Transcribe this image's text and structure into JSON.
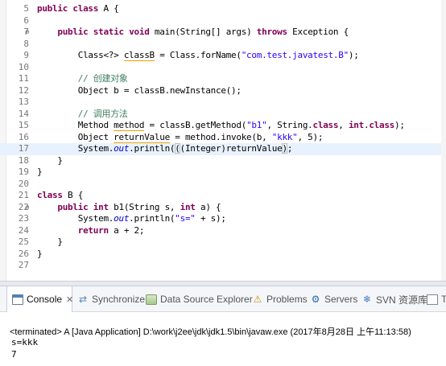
{
  "editor": {
    "lines": [
      {
        "num": "5",
        "fold": "",
        "current": false,
        "tokens": [
          {
            "t": "public",
            "c": "kw"
          },
          {
            "t": " "
          },
          {
            "t": "class",
            "c": "kw"
          },
          {
            "t": " A {"
          }
        ]
      },
      {
        "num": "6",
        "fold": "",
        "current": false,
        "tokens": []
      },
      {
        "num": "7",
        "fold": "⊖",
        "current": false,
        "tokens": [
          {
            "t": "    "
          },
          {
            "t": "public",
            "c": "kw"
          },
          {
            "t": " "
          },
          {
            "t": "static",
            "c": "kw"
          },
          {
            "t": " "
          },
          {
            "t": "void",
            "c": "kw"
          },
          {
            "t": " main(String[] args) "
          },
          {
            "t": "throws",
            "c": "kw"
          },
          {
            "t": " Exception {"
          }
        ]
      },
      {
        "num": "8",
        "fold": "",
        "current": false,
        "tokens": []
      },
      {
        "num": "9",
        "fold": "",
        "current": false,
        "tokens": [
          {
            "t": "        Class<?> "
          },
          {
            "t": "classB",
            "c": "warn"
          },
          {
            "t": " = Class.forName("
          },
          {
            "t": "\"com.test.javatest.B\"",
            "c": "str"
          },
          {
            "t": ");"
          }
        ]
      },
      {
        "num": "10",
        "fold": "",
        "current": false,
        "tokens": []
      },
      {
        "num": "11",
        "fold": "",
        "current": false,
        "tokens": [
          {
            "t": "        "
          },
          {
            "t": "// 创建对象",
            "c": "cm"
          }
        ]
      },
      {
        "num": "12",
        "fold": "",
        "current": false,
        "tokens": [
          {
            "t": "        Object b = classB.newInstance();"
          }
        ]
      },
      {
        "num": "13",
        "fold": "",
        "current": false,
        "tokens": []
      },
      {
        "num": "14",
        "fold": "",
        "current": false,
        "tokens": [
          {
            "t": "        "
          },
          {
            "t": "// 调用方法",
            "c": "cm"
          }
        ]
      },
      {
        "num": "15",
        "fold": "",
        "current": false,
        "tokens": [
          {
            "t": "        Method "
          },
          {
            "t": "method",
            "c": "warn"
          },
          {
            "t": " = classB.getMethod("
          },
          {
            "t": "\"b1\"",
            "c": "str"
          },
          {
            "t": ", String."
          },
          {
            "t": "class",
            "c": "kw"
          },
          {
            "t": ", "
          },
          {
            "t": "int",
            "c": "kw"
          },
          {
            "t": "."
          },
          {
            "t": "class",
            "c": "kw"
          },
          {
            "t": ");"
          }
        ]
      },
      {
        "num": "16",
        "fold": "",
        "current": false,
        "tokens": [
          {
            "t": "        Object "
          },
          {
            "t": "returnValue",
            "c": "warn"
          },
          {
            "t": " = method.invoke(b, "
          },
          {
            "t": "\"kkk\"",
            "c": "str"
          },
          {
            "t": ", 5);"
          }
        ]
      },
      {
        "num": "17",
        "fold": "",
        "current": true,
        "tokens": [
          {
            "t": "        System."
          },
          {
            "t": "out",
            "c": "fld"
          },
          {
            "t": ".println("
          },
          {
            "t": "(",
            "c": "bkt"
          },
          {
            "t": "(Integer)returnValue"
          },
          {
            "t": ")",
            "c": "bkt"
          },
          {
            "t": ";"
          }
        ]
      },
      {
        "num": "18",
        "fold": "",
        "current": false,
        "tokens": [
          {
            "t": "    }"
          }
        ]
      },
      {
        "num": "19",
        "fold": "",
        "current": false,
        "tokens": [
          {
            "t": "}"
          }
        ]
      },
      {
        "num": "20",
        "fold": "",
        "current": false,
        "tokens": []
      },
      {
        "num": "21",
        "fold": "",
        "current": false,
        "tokens": [
          {
            "t": "class",
            "c": "kw"
          },
          {
            "t": " B {"
          }
        ]
      },
      {
        "num": "22",
        "fold": "⊖",
        "current": false,
        "tokens": [
          {
            "t": "    "
          },
          {
            "t": "public",
            "c": "kw"
          },
          {
            "t": " "
          },
          {
            "t": "int",
            "c": "kw"
          },
          {
            "t": " b1(String s, "
          },
          {
            "t": "int",
            "c": "kw"
          },
          {
            "t": " a) {"
          }
        ]
      },
      {
        "num": "23",
        "fold": "",
        "current": false,
        "tokens": [
          {
            "t": "        System."
          },
          {
            "t": "out",
            "c": "fld"
          },
          {
            "t": ".println("
          },
          {
            "t": "\"s=\"",
            "c": "str"
          },
          {
            "t": " + s);"
          }
        ]
      },
      {
        "num": "24",
        "fold": "",
        "current": false,
        "tokens": [
          {
            "t": "        "
          },
          {
            "t": "return",
            "c": "kw"
          },
          {
            "t": " a + 2;"
          }
        ]
      },
      {
        "num": "25",
        "fold": "",
        "current": false,
        "tokens": [
          {
            "t": "    }"
          }
        ]
      },
      {
        "num": "26",
        "fold": "",
        "current": false,
        "tokens": [
          {
            "t": "}"
          }
        ]
      },
      {
        "num": "27",
        "fold": "",
        "current": false,
        "tokens": []
      }
    ]
  },
  "tabs": [
    {
      "label": "Console",
      "icon": "console-icon",
      "active": true,
      "closable": true,
      "close_glyph": "✕"
    },
    {
      "label": "Synchronize",
      "icon": "synchronize-icon",
      "active": false,
      "icon_glyph": "⇄"
    },
    {
      "label": "Data Source Explorer",
      "icon": "data-source-explorer-icon",
      "active": false
    },
    {
      "label": "Problems",
      "icon": "problems-icon",
      "active": false,
      "icon_glyph": "⚠"
    },
    {
      "label": "Servers",
      "icon": "servers-icon",
      "active": false,
      "icon_glyph": "⚙"
    },
    {
      "label": "SVN 资源库",
      "icon": "svn-repository-icon",
      "active": false,
      "icon_glyph": "❄"
    },
    {
      "label": "T",
      "icon": "tasks-icon",
      "active": false
    }
  ],
  "console": {
    "header": "<terminated> A [Java Application] D:\\work\\j2ee\\jdk\\jdk1.5\\bin\\javaw.exe (2017年8月28日 上午11:13:58)",
    "output": [
      "s=kkk",
      "7"
    ]
  }
}
